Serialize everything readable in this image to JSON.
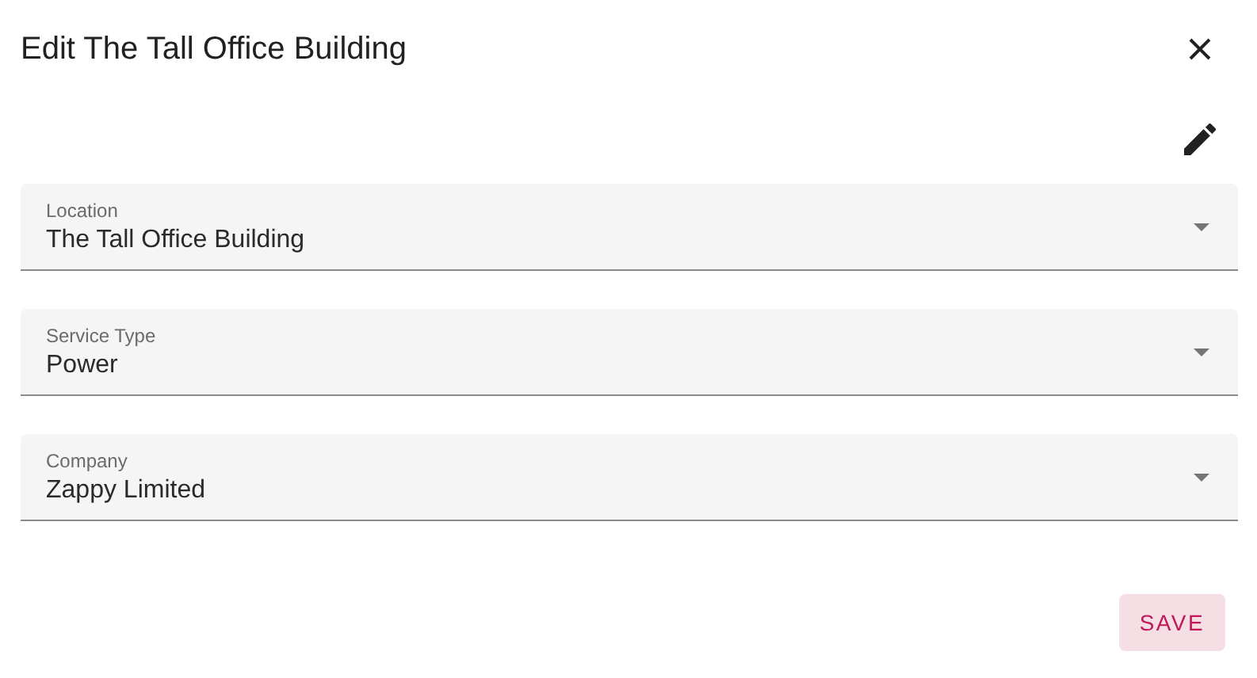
{
  "dialog": {
    "title": "Edit The Tall Office Building"
  },
  "fields": [
    {
      "label": "Location",
      "value": "The Tall Office Building"
    },
    {
      "label": "Service Type",
      "value": "Power"
    },
    {
      "label": "Company",
      "value": "Zappy Limited"
    }
  ],
  "buttons": [
    {
      "label": "SAVE",
      "disabled": false
    }
  ]
}
